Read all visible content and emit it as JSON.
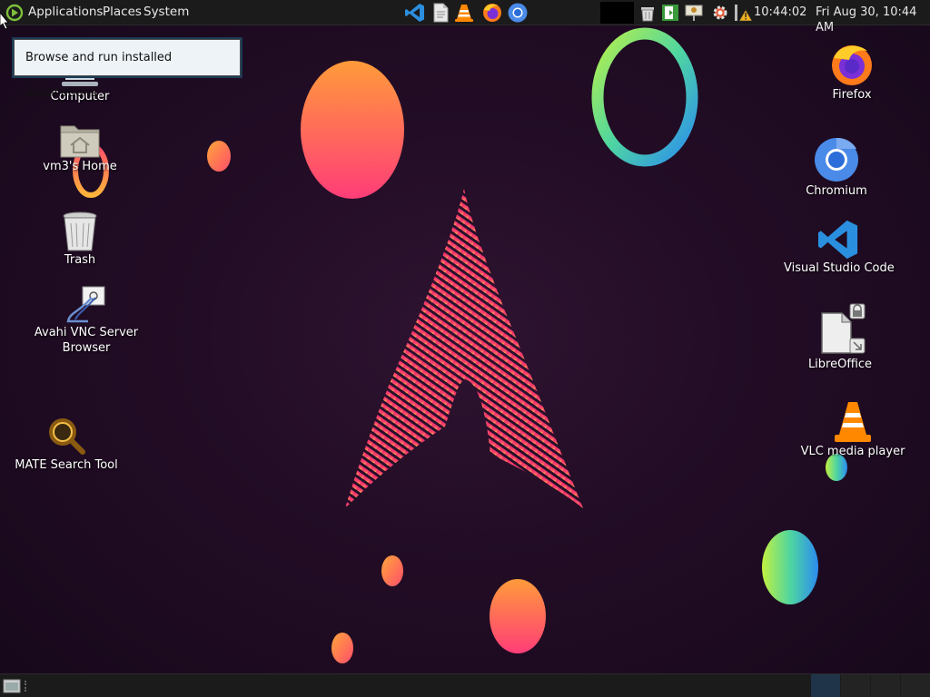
{
  "top_panel": {
    "menus": [
      "Applications",
      "Places",
      "System"
    ],
    "launchers": [
      "vscode-icon",
      "text-editor-icon",
      "vlc-icon",
      "firefox-icon",
      "chromium-icon"
    ],
    "tray_icons": [
      "trash-icon",
      "exit-icon",
      "presentation-icon",
      "settings-gear-icon",
      "update-warning-icon"
    ],
    "time": "10:44:02",
    "datetime": "Fri Aug 30, 10:44 AM"
  },
  "tooltip": {
    "text": "Browse and run installed applications"
  },
  "desktop": {
    "left_icons": [
      {
        "label": "Computer",
        "icon": "computer-icon"
      },
      {
        "label": "vm3's Home",
        "icon": "home-folder-icon"
      },
      {
        "label": "Trash",
        "icon": "trash-icon"
      },
      {
        "label": "Avahi VNC Server Browser",
        "icon": "vnc-icon"
      },
      {
        "label": "MATE Search Tool",
        "icon": "search-tool-icon"
      }
    ],
    "right_icons": [
      {
        "label": "Firefox",
        "icon": "firefox-icon"
      },
      {
        "label": "Chromium",
        "icon": "chromium-icon"
      },
      {
        "label": "Visual Studio Code",
        "icon": "vscode-icon"
      },
      {
        "label": "LibreOffice",
        "icon": "libreoffice-icon"
      },
      {
        "label": "VLC media player",
        "icon": "vlc-icon"
      }
    ]
  },
  "colors": {
    "panel": "#1b1b1b",
    "wallpaper_bg": "#230d26",
    "accent_pink": "#e8226e",
    "accent_orange": "#ff9a3c"
  }
}
